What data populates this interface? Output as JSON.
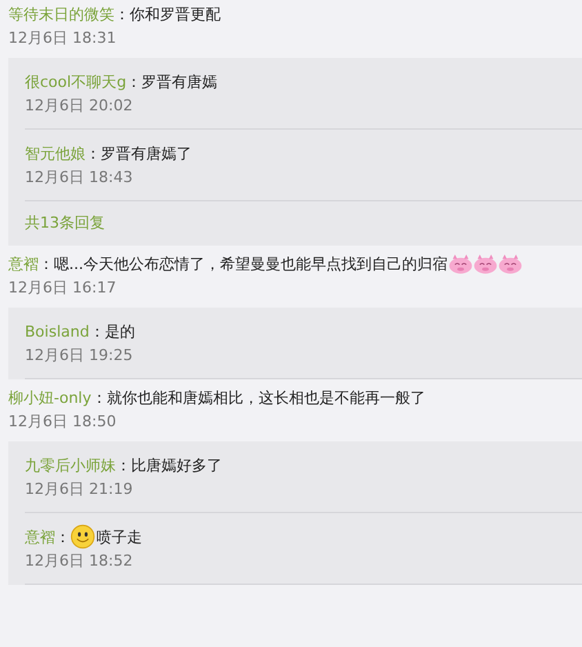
{
  "comments": [
    {
      "user": "等待末日的微笑",
      "parts": [
        {
          "kind": "text",
          "text": "：你和罗晋更配"
        }
      ],
      "time": "12月6日 18:31",
      "replies": [
        {
          "user": "很cool不聊天g",
          "parts": [
            {
              "kind": "text",
              "text": "：罗晋有唐嫣"
            }
          ],
          "time": "12月6日 20:02"
        },
        {
          "user": "智元他娘",
          "parts": [
            {
              "kind": "text",
              "text": "：罗晋有唐嫣了"
            }
          ],
          "time": "12月6日 18:43"
        }
      ],
      "more": "共13条回复"
    },
    {
      "user": "意褶",
      "parts": [
        {
          "kind": "text",
          "text": "：嗯...今天他公布恋情了，希望曼曼也能早点找到自己的归宿"
        },
        {
          "kind": "sticker"
        },
        {
          "kind": "sticker"
        },
        {
          "kind": "sticker"
        }
      ],
      "time": "12月6日 16:17",
      "replies": [
        {
          "user": "Boisland",
          "parts": [
            {
              "kind": "text",
              "text": "：是的"
            }
          ],
          "time": "12月6日 19:25"
        }
      ]
    },
    {
      "user": "柳小妞-only",
      "parts": [
        {
          "kind": "text",
          "text": "：就你也能和唐嫣相比，这长相也是不能再一般了"
        }
      ],
      "time": "12月6日 18:50",
      "replies": [
        {
          "user": "九零后小师妹",
          "parts": [
            {
              "kind": "text",
              "text": "：比唐嫣好多了"
            }
          ],
          "time": "12月6日 21:19"
        },
        {
          "user": "意褶",
          "parts": [
            {
              "kind": "text",
              "text": "："
            },
            {
              "kind": "smiley"
            },
            {
              "kind": "text",
              "text": "喷子走"
            }
          ],
          "time": "12月6日 18:52"
        }
      ]
    }
  ]
}
